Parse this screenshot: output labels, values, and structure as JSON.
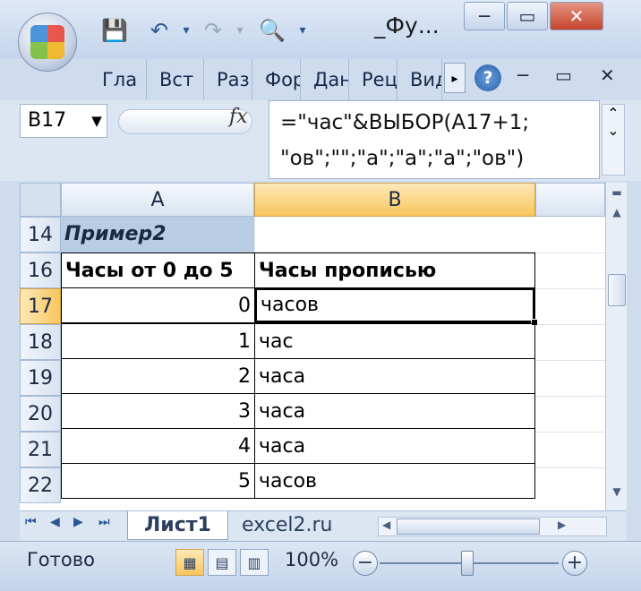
{
  "title": {
    "caption": "_Фу...",
    "minimize": "─",
    "restore": "▭",
    "close": "✕"
  },
  "ribbon": {
    "tabs": [
      "Гла",
      "Вст",
      "Раз",
      "Фор",
      "Дан",
      "Рец",
      "Вид"
    ],
    "scroll": "▸"
  },
  "formula_bar": {
    "name_box": "B17",
    "fx": "fx",
    "formula_line1": "=\"час\"&ВЫБОР(A17+1;",
    "formula_line2": "\"ов\";\"\";\"а\";\"а\";\"а\";\"ов\")"
  },
  "columns": [
    "A",
    "B"
  ],
  "rows": [
    {
      "num": "14",
      "a": "Пример2",
      "b": ""
    },
    {
      "num": "16",
      "a": "Часы от 0 до 5",
      "b": "Часы прописью"
    },
    {
      "num": "17",
      "a": "0",
      "b": "часов"
    },
    {
      "num": "18",
      "a": "1",
      "b": "час"
    },
    {
      "num": "19",
      "a": "2",
      "b": "часа"
    },
    {
      "num": "20",
      "a": "3",
      "b": "часа"
    },
    {
      "num": "21",
      "a": "4",
      "b": "часа"
    },
    {
      "num": "22",
      "a": "5",
      "b": "часов"
    }
  ],
  "sheets": {
    "active": "Лист1",
    "other": "excel2.ru"
  },
  "status": {
    "ready": "Готово",
    "zoom": "100%"
  },
  "colors": {
    "header_fill": "#b8cce4",
    "selection_highlight": "#f8c65c"
  }
}
